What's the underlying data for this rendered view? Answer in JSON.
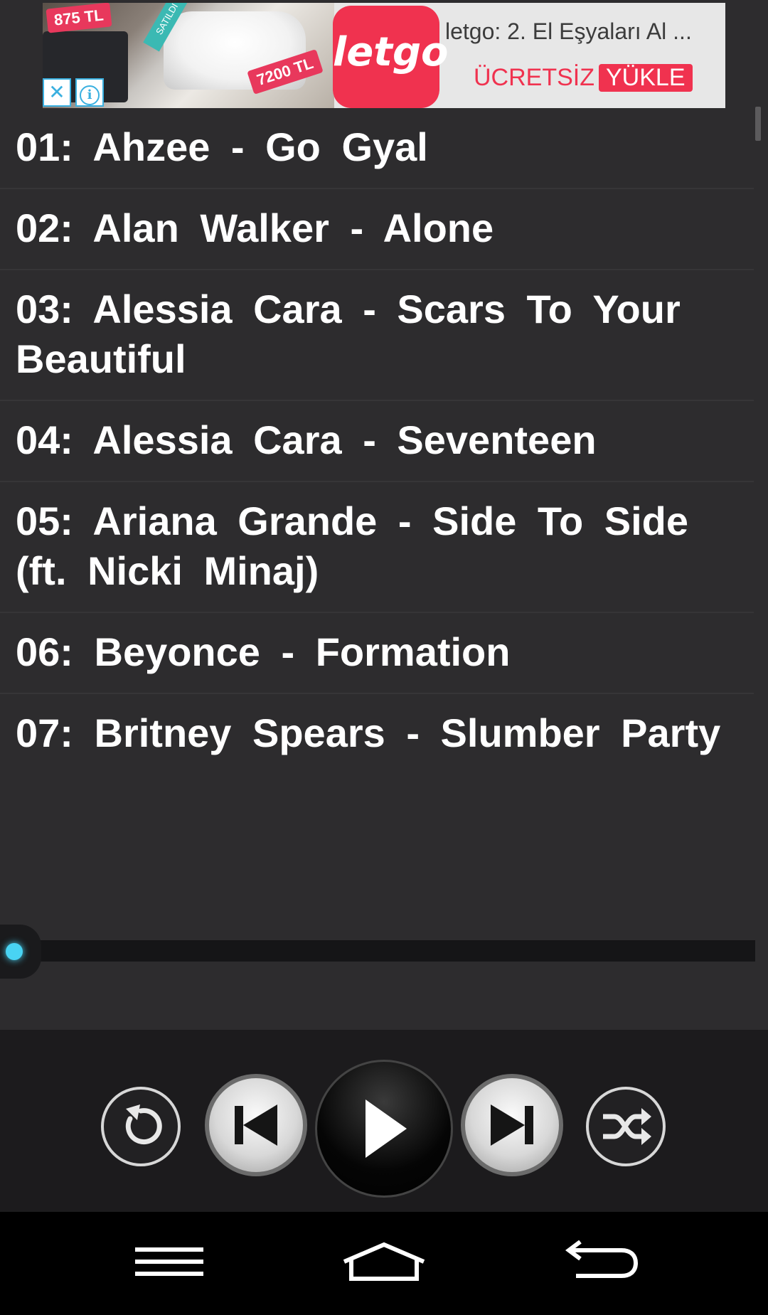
{
  "ad": {
    "price_small": "875 TL",
    "price_large": "7200 TL",
    "sold_band": "SATILDI",
    "logo_text": "letgo",
    "title": "letgo: 2. El Eşyaları Al ...",
    "cta_free": "ÜCRETSİZ",
    "cta_install": "YÜKLE",
    "close_glyph": "✕",
    "info_glyph": "i"
  },
  "tracks": [
    "01: Ahzee - Go Gyal",
    "02: Alan Walker - Alone",
    "03: Alessia Cara - Scars To Your Beautiful",
    "04: Alessia Cara - Seventeen",
    "05: Ariana Grande - Side To Side (ft. Nicki Minaj)",
    "06: Beyonce - Formation",
    "07: Britney Spears - Slumber Party"
  ],
  "player": {
    "progress": 0.0,
    "accent": "#49d3f3",
    "buttons": [
      "repeat-icon",
      "previous-icon",
      "play-icon",
      "next-icon",
      "shuffle-icon"
    ]
  },
  "navbar": {
    "icons": [
      "menu-icon",
      "home-icon",
      "back-icon"
    ]
  }
}
